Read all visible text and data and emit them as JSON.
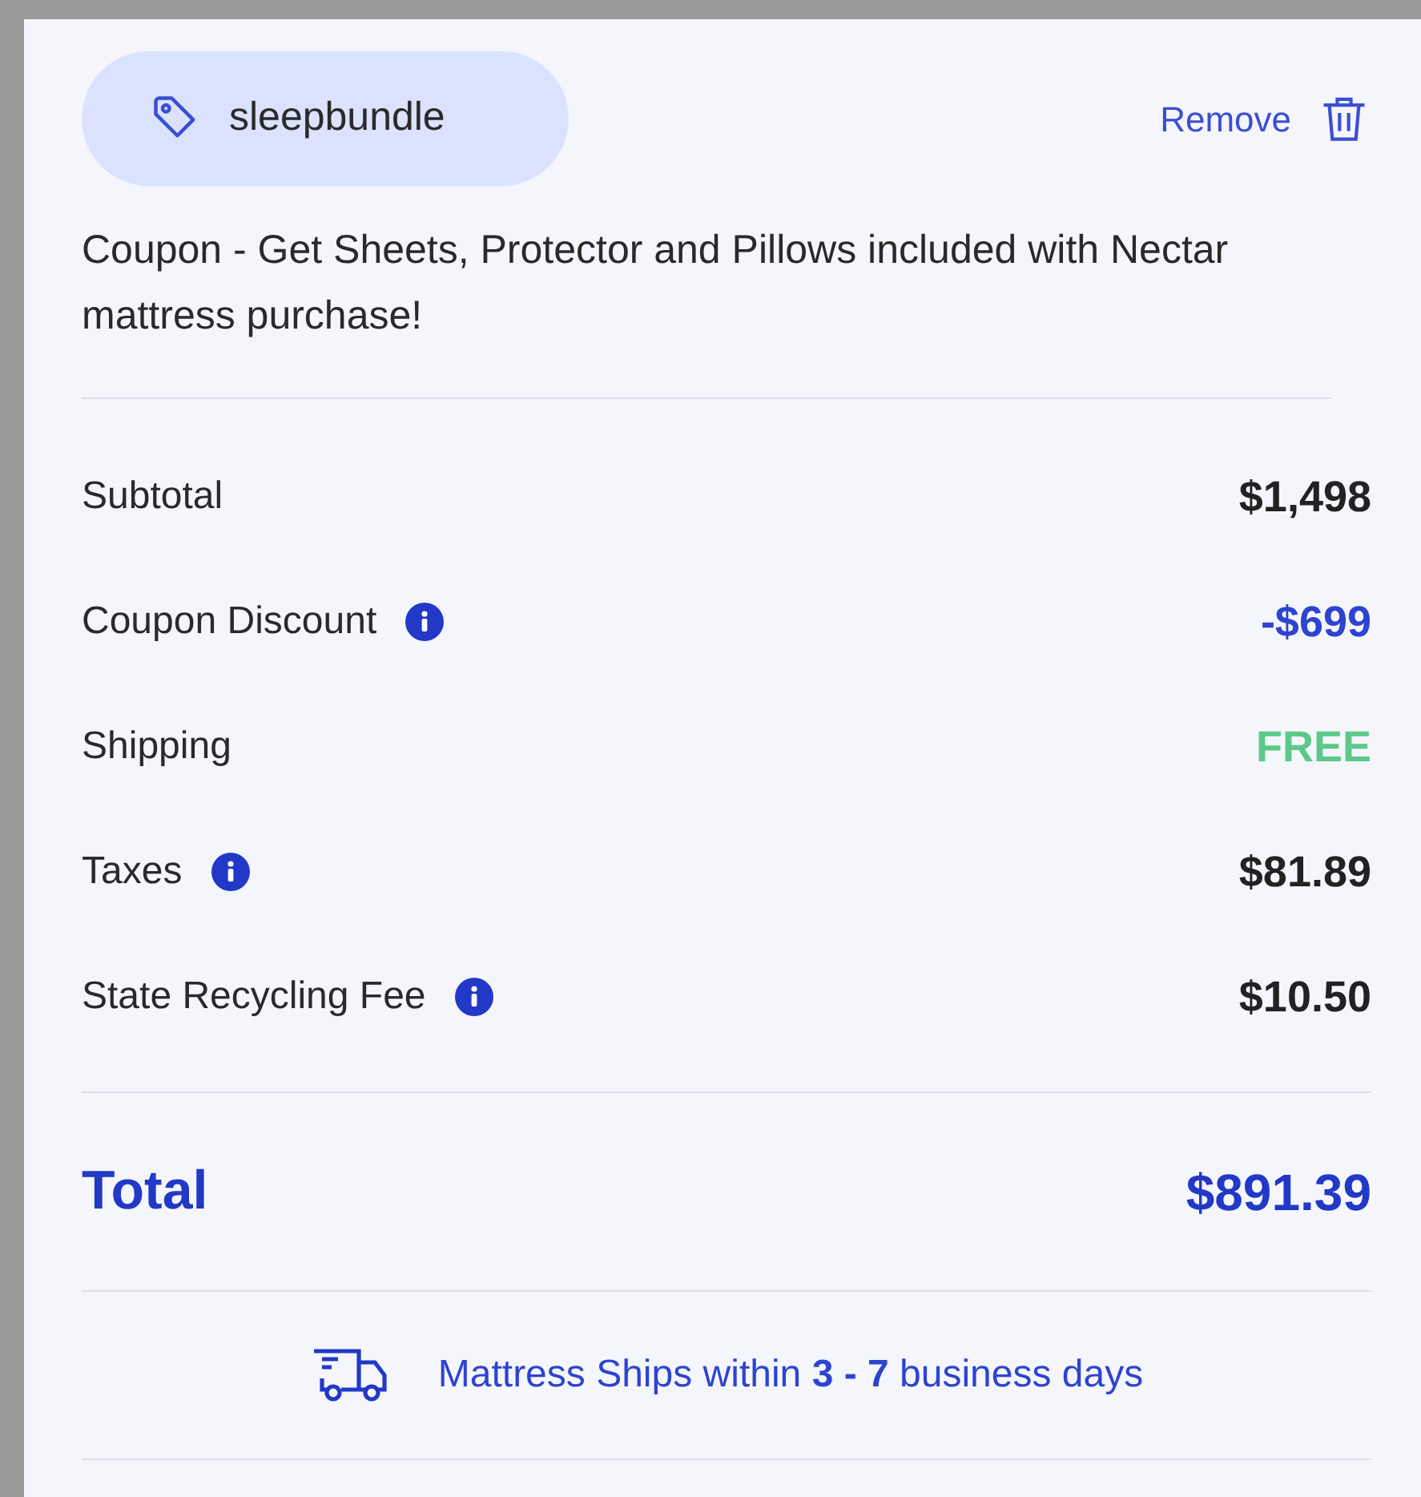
{
  "coupon": {
    "code": "sleepbundle",
    "remove_label": "Remove",
    "description": "Coupon - Get Sheets, Protector and Pillows included with Nectar mattress purchase!"
  },
  "lines": [
    {
      "label": "Subtotal",
      "value": "$1,498",
      "info": false,
      "kind": "default"
    },
    {
      "label": "Coupon Discount",
      "value": "-$699",
      "info": true,
      "kind": "discount"
    },
    {
      "label": "Shipping",
      "value": "FREE",
      "info": false,
      "kind": "free"
    },
    {
      "label": "Taxes",
      "value": "$81.89",
      "info": true,
      "kind": "default"
    },
    {
      "label": "State Recycling Fee",
      "value": "$10.50",
      "info": true,
      "kind": "default"
    }
  ],
  "total": {
    "label": "Total",
    "value": "$891.39"
  },
  "shipping_note": "Mattress Ships within **3 - 7** business days"
}
